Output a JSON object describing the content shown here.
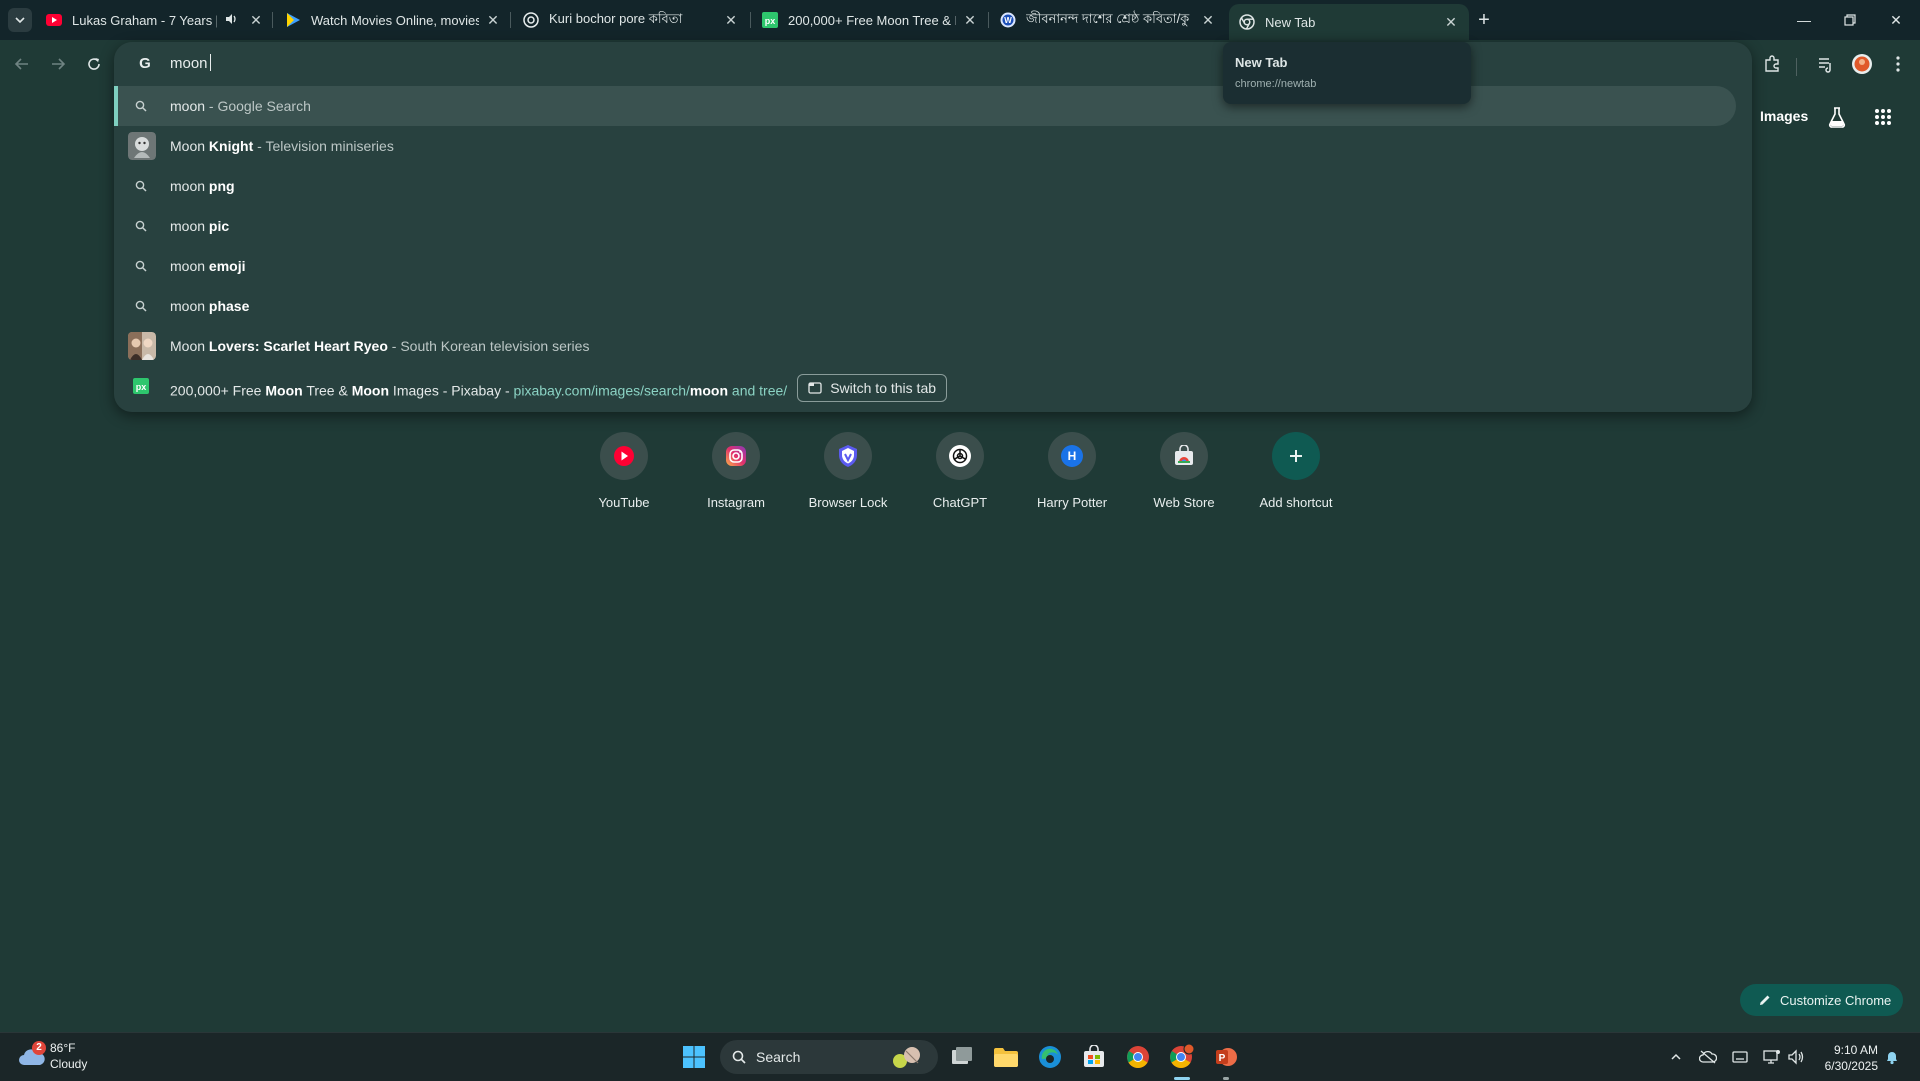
{
  "tabs": [
    {
      "title": "Lukas Graham - 7 Years [Official",
      "icon": "youtube-icon",
      "audio": true
    },
    {
      "title": "Watch Movies Online, movies se",
      "icon": "play-icon"
    },
    {
      "title": "Kuri bochor pore কবিতা",
      "icon": "chatgpt-icon"
    },
    {
      "title": "200,000+ Free Moon Tree & Mo",
      "icon": "pixabay-icon"
    },
    {
      "title": "জীবনানন্দ দাশের শ্রেষ্ঠ কবিতা/কু",
      "icon": "site-icon"
    },
    {
      "title": "New Tab",
      "icon": "chrome-icon"
    }
  ],
  "hover_card": {
    "title": "New Tab",
    "url": "chrome://newtab"
  },
  "omnibox": {
    "query": "moon",
    "suggestions": [
      {
        "prefix": "moon",
        "bold": "",
        "suffix": " - Google Search",
        "type": "search"
      },
      {
        "prefix": "Moon",
        "bold": " Knight",
        "suffix": " - Television miniseries",
        "type": "entity"
      },
      {
        "prefix": "moon",
        "bold": " png",
        "suffix": "",
        "type": "search"
      },
      {
        "prefix": "moon",
        "bold": " pic",
        "suffix": "",
        "type": "search"
      },
      {
        "prefix": "moon",
        "bold": " emoji",
        "suffix": "",
        "type": "search"
      },
      {
        "prefix": "moon",
        "bold": " phase",
        "suffix": "",
        "type": "search"
      },
      {
        "prefix": "Moon",
        "bold": " Lovers: Scarlet Heart Ryeo",
        "suffix": " - South Korean television series",
        "type": "entity"
      }
    ],
    "tab_match": {
      "t1": "200,000+ Free ",
      "t2": "Moon",
      "t3": " Tree & ",
      "t4": "Moon",
      "t5": " Images - Pixabay - ",
      "u1": "pixabay.com/images/search/",
      "u2": "moon",
      "u3": " and tree/",
      "button": "Switch to this tab"
    }
  },
  "header": {
    "images": "Images"
  },
  "shortcuts": [
    {
      "label": "YouTube",
      "icon": "youtube-icon"
    },
    {
      "label": "Instagram",
      "icon": "instagram-icon"
    },
    {
      "label": "Browser Lock",
      "icon": "shield-icon"
    },
    {
      "label": "ChatGPT",
      "icon": "chatgpt-icon"
    },
    {
      "label": "Harry Potter",
      "icon": "letter-h-icon",
      "letter": "H"
    },
    {
      "label": "Web Store",
      "icon": "web-store-icon"
    },
    {
      "label": "Add shortcut",
      "icon": "plus-icon"
    }
  ],
  "customize": "Customize Chrome",
  "taskbar": {
    "weather_temp": "86°F",
    "weather_cond": "Cloudy",
    "weather_badge": "2",
    "search": "Search",
    "time": "9:10 AM",
    "date": "6/30/2025"
  },
  "colors": {
    "accent": "#7fd0c0",
    "background": "#1f3a36",
    "dropdown": "#28413f"
  }
}
